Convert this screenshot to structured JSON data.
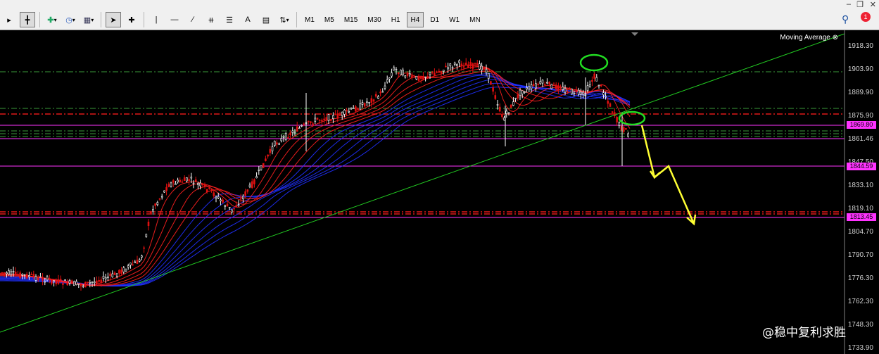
{
  "toolbar": {
    "timeframes": [
      "M1",
      "M5",
      "M15",
      "M30",
      "H1",
      "H4",
      "D1",
      "W1",
      "MN"
    ],
    "active_timeframe": "H4",
    "text_tool": "A",
    "notification_count": "1"
  },
  "indicator": {
    "name": "Moving Average"
  },
  "price_axis": {
    "labels": [
      "1918.30",
      "1903.90",
      "1889.90",
      "1875.90",
      "1861.46",
      "1847.50",
      "1833.10",
      "1819.10",
      "1804.70",
      "1790.70",
      "1776.30",
      "1762.30",
      "1748.30",
      "1733.90"
    ]
  },
  "price_tags": {
    "upper": "1869.80",
    "middle": "1844.59",
    "lower": "1813.45"
  },
  "watermark": {
    "text": "@稳中复利求胜"
  },
  "colors": {
    "background": "#000000",
    "bull_candle": "#ffffff",
    "bear_candle": "#e01010",
    "ma_fast": "#ff2020",
    "ma_slow": "#2030ff",
    "trendline": "#22cc22",
    "forecast_arrow": "#ffff33",
    "magenta_line": "#ff33ff"
  }
}
